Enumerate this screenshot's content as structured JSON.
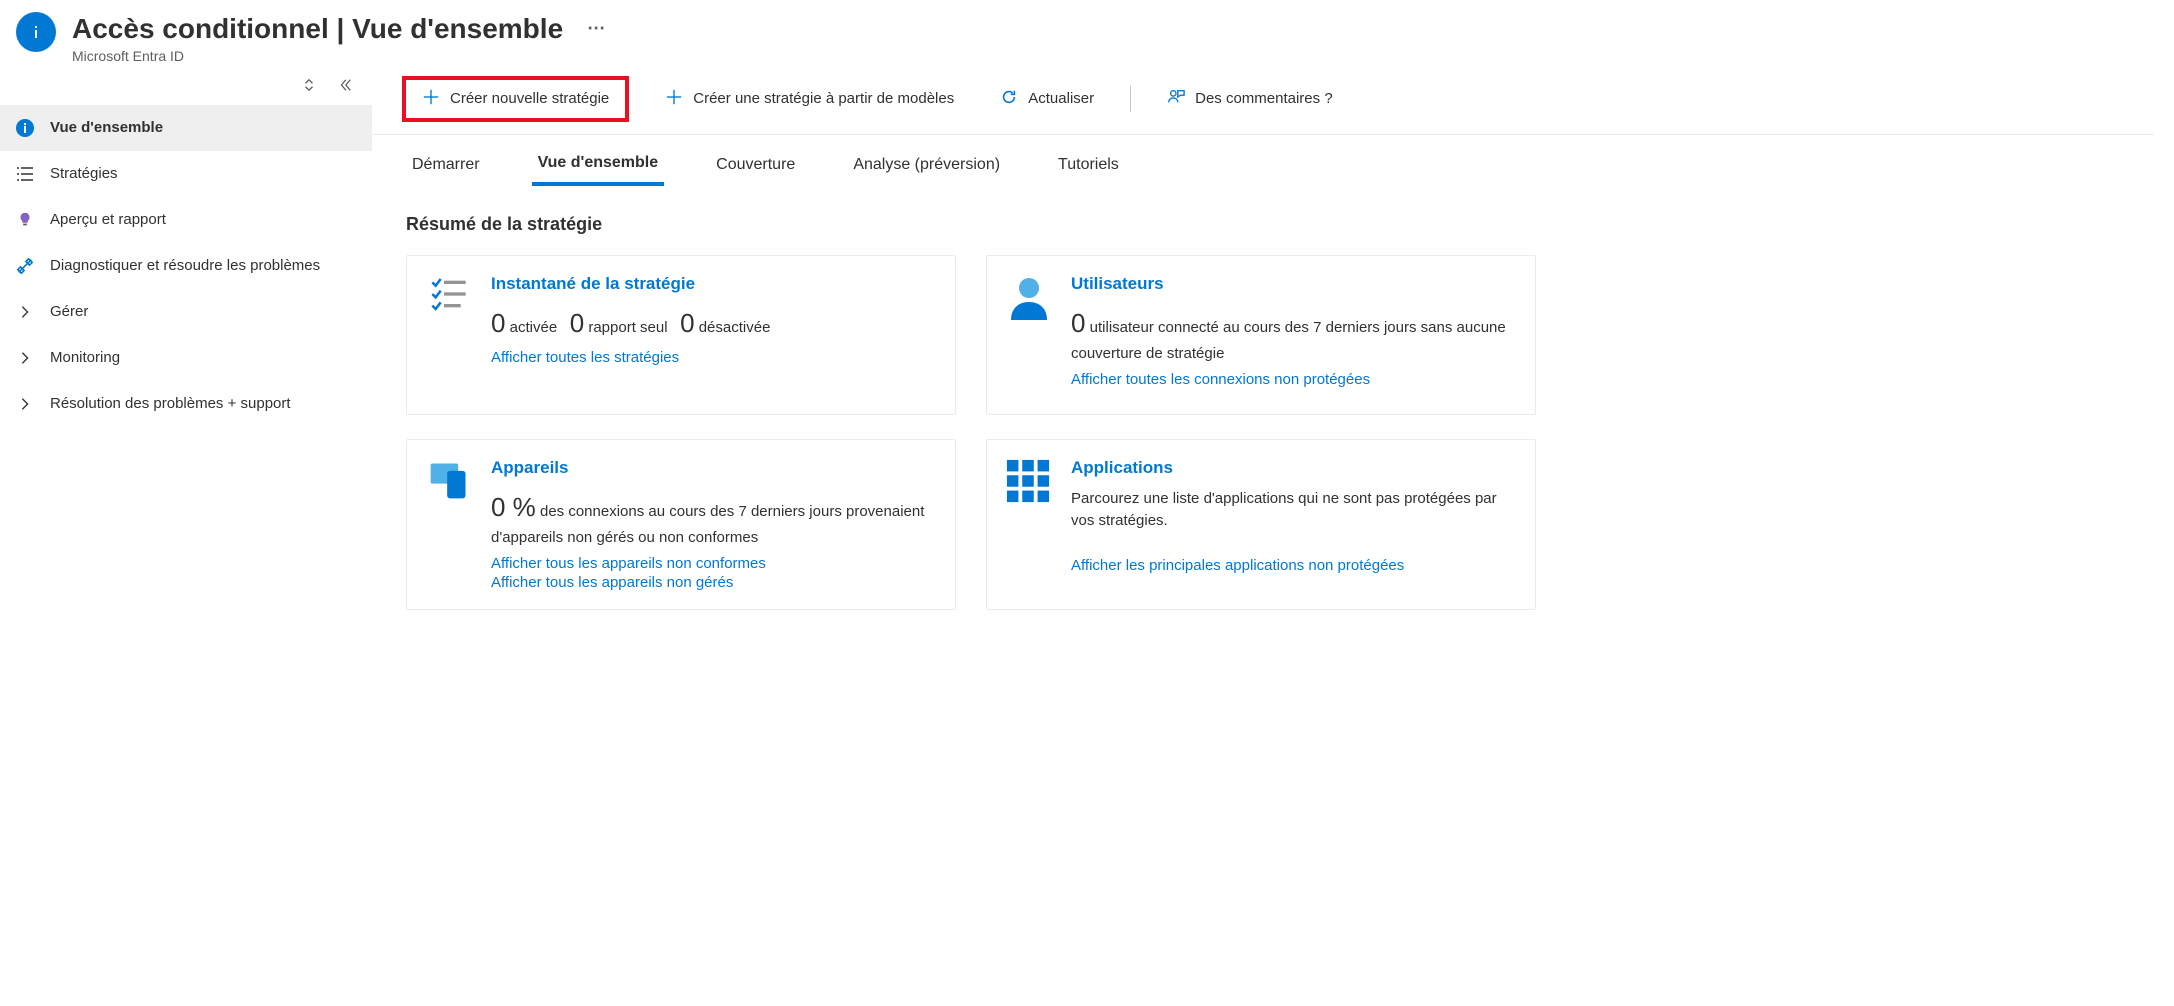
{
  "header": {
    "title": "Accès conditionnel | Vue d'ensemble",
    "subtitle": "Microsoft Entra ID"
  },
  "sidebar": {
    "items": [
      {
        "label": "Vue d'ensemble"
      },
      {
        "label": "Stratégies"
      },
      {
        "label": "Aperçu et rapport"
      },
      {
        "label": "Diagnostiquer et résoudre les problèmes"
      },
      {
        "label": "Gérer"
      },
      {
        "label": "Monitoring"
      },
      {
        "label": "Résolution des problèmes + support"
      }
    ]
  },
  "toolbar": {
    "create_new": "Créer nouvelle stratégie",
    "create_from_template": "Créer une stratégie à partir de modèles",
    "refresh": "Actualiser",
    "feedback": "Des commentaires ?"
  },
  "tabs": {
    "start": "Démarrer",
    "overview": "Vue d'ensemble",
    "coverage": "Couverture",
    "analysis": "Analyse (préversion)",
    "tutorials": "Tutoriels"
  },
  "summary": {
    "heading": "Résumé de la stratégie",
    "cards": {
      "snapshot": {
        "title": "Instantané de la stratégie",
        "val_enabled": "0",
        "lbl_enabled": "activée",
        "val_report": "0",
        "lbl_report": "rapport seul",
        "val_disabled": "0",
        "lbl_disabled": "désactivée",
        "link": "Afficher toutes les stratégies"
      },
      "users": {
        "title": "Utilisateurs",
        "val": "0",
        "text": "utilisateur connecté au cours des 7 derniers jours sans aucune couverture de stratégie",
        "link": "Afficher toutes les connexions non protégées"
      },
      "devices": {
        "title": "Appareils",
        "val": "0 %",
        "text": "des connexions au cours des 7 derniers jours provenaient d'appareils non gérés ou non conformes",
        "link1": "Afficher tous les appareils non conformes",
        "link2": "Afficher tous les appareils non gérés"
      },
      "apps": {
        "title": "Applications",
        "text": "Parcourez une liste d'applications qui ne sont pas protégées par vos stratégies.",
        "link": "Afficher les principales applications non protégées"
      }
    }
  }
}
